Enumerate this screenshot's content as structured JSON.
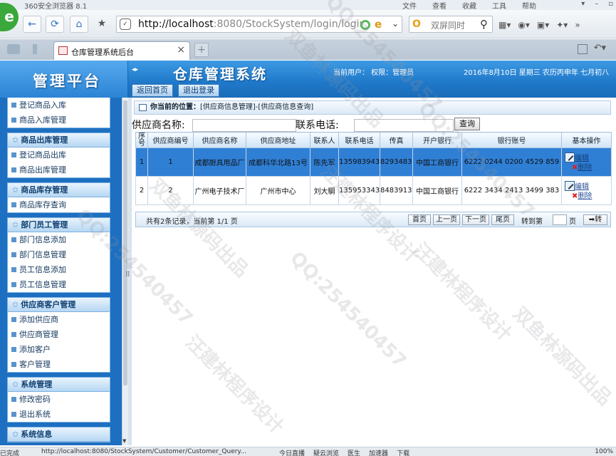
{
  "browser": {
    "title": "360安全浏览器 8.1",
    "menus": [
      "文件",
      "查看",
      "收藏",
      "工具",
      "帮助"
    ],
    "url_host": "http://localhost",
    "url_rest": ":8080/StockSystem/login/logir",
    "search_placeholder": "双屏同时",
    "tab_title": "仓库管理系统后台",
    "status_left": "已完成",
    "status_url": "http://localhost:8080/StockSystem/Customer/Customer_Query...",
    "status_items": [
      "今日直播",
      "疑云浏览",
      "医生",
      "加速器",
      "下载"
    ],
    "zoom": "100%"
  },
  "header": {
    "brand": "管理平台",
    "system_title": "仓库管理系统",
    "user_info": "当前用户：  权限：管理员",
    "date_info": "2016年8月10日 星期三 农历丙申年 七月初八",
    "btn_home": "返回首页",
    "btn_logout": "退出登录"
  },
  "sidebar": {
    "groups": [
      {
        "title": "",
        "items": [
          "登记商品入库",
          "商品入库管理"
        ]
      },
      {
        "title": "商品出库管理",
        "items": [
          "登记商品出库",
          "商品出库管理"
        ]
      },
      {
        "title": "商品库存管理",
        "items": [
          "商品库存查询"
        ]
      },
      {
        "title": "部门员工管理",
        "items": [
          "部门信息添加",
          "部门信息管理",
          "员工信息添加",
          "员工信息管理"
        ]
      },
      {
        "title": "供应商客户管理",
        "items": [
          "添加供应商",
          "供应商管理",
          "添加客户",
          "客户管理"
        ]
      },
      {
        "title": "系统管理",
        "items": [
          "修改密码",
          "退出系统"
        ]
      },
      {
        "title": "系统信息",
        "items": []
      }
    ]
  },
  "main": {
    "crumb_label": "你当前的位置：",
    "crumb_path": "[供应商信息管理]-[供应商信息查询]",
    "filter": {
      "name_label": "供应商名称:",
      "phone_label": "联系电话:",
      "search_button": "查询"
    },
    "table": {
      "headers": [
        "序号",
        "供应商编号",
        "供应商名称",
        "供应商地址",
        "联系人",
        "联系电话",
        "传真",
        "开户银行",
        "银行账号",
        "基本操作"
      ],
      "rows": [
        [
          "1",
          "1",
          "成都厨具用品厂",
          "成都科华北路13号",
          "陈先军",
          "13598394383",
          "82934839",
          "中国工商银行",
          "6222 0244 0200 4529 859",
          ""
        ],
        [
          "2",
          "2",
          "广州电子技术厂",
          "广州市中心",
          "刘大騆",
          "13595334383",
          "84839134",
          "中国工商银行",
          "6222 3434 2413 3499 383",
          ""
        ]
      ],
      "edit_label": "编辑",
      "delete_label": "删除"
    },
    "pager": {
      "info": "共有2条记录，当前第 1/1 页",
      "first": "首页",
      "prev": "上一页",
      "next": "下一页",
      "last": "尾页",
      "goto_label": "转到第",
      "page_unit": "页",
      "go_button": "➡转"
    }
  },
  "watermark": [
    "双鱼林源码出品",
    "QQ:254540457",
    "汪建林程序设计"
  ],
  "colors": {
    "header_blue": "#1f78c9",
    "sidebar_blue": "#1d6fc1",
    "selected_row": "#2f7fd5"
  }
}
